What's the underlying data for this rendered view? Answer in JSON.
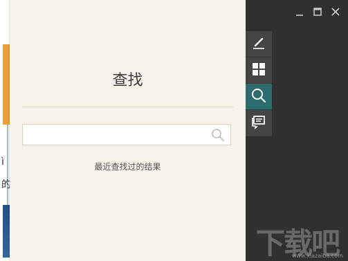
{
  "document": {
    "fragments": [
      "ì",
      "的"
    ]
  },
  "search_panel": {
    "title": "查找",
    "search_input_value": "",
    "search_input_placeholder": "",
    "recent_results_label": "最近查找过的结果"
  },
  "window_controls": {
    "minimize_icon": "minimize-icon",
    "maximize_icon": "maximize-icon",
    "close_icon": "close-icon"
  },
  "toolbar": {
    "items": [
      {
        "icon": "pen-icon",
        "active": false
      },
      {
        "icon": "grid-icon",
        "active": false
      },
      {
        "icon": "search-icon",
        "active": true
      },
      {
        "icon": "comment-icon",
        "active": false
      }
    ]
  },
  "watermark": {
    "text": "下载吧",
    "url": "www.xiazaiba.com"
  },
  "colors": {
    "panel_bg": "#f6f3ea",
    "dark_bg": "#303030",
    "tool_bg": "#444444",
    "tool_active": "#2b6d6f",
    "orange_accent": "#e7a03b"
  }
}
